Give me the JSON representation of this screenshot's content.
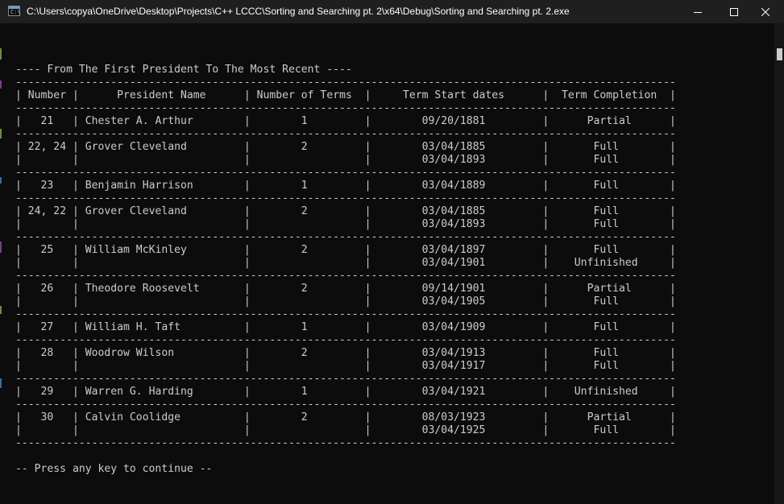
{
  "window": {
    "title": "C:\\Users\\copya\\OneDrive\\Desktop\\Projects\\C++ LCCC\\Sorting and Searching pt. 2\\x64\\Debug\\Sorting and Searching pt. 2.exe",
    "icon_label": "C:\\",
    "icons": {
      "app": "console-app-icon",
      "minimize": "minimize-icon",
      "maximize": "maximize-icon",
      "close": "close-icon"
    }
  },
  "console": {
    "heading": "---- From The First President To The Most Recent ----",
    "separator": "-----------------------------------------------------------------------------------------------------------",
    "columns": [
      "Number",
      "President Name",
      "Number of Terms",
      "Term Start dates",
      "Term Completion"
    ],
    "rows": [
      {
        "number": "21",
        "name": "Chester A. Arthur",
        "terms": "1",
        "starts": [
          "09/20/1881"
        ],
        "completion": [
          "Partial"
        ]
      },
      {
        "number": "22, 24",
        "name": "Grover Cleveland",
        "terms": "2",
        "starts": [
          "03/04/1885",
          "03/04/1893"
        ],
        "completion": [
          "Full",
          "Full"
        ]
      },
      {
        "number": "23",
        "name": "Benjamin Harrison",
        "terms": "1",
        "starts": [
          "03/04/1889"
        ],
        "completion": [
          "Full"
        ]
      },
      {
        "number": "24, 22",
        "name": "Grover Cleveland",
        "terms": "2",
        "starts": [
          "03/04/1885",
          "03/04/1893"
        ],
        "completion": [
          "Full",
          "Full"
        ]
      },
      {
        "number": "25",
        "name": "William McKinley",
        "terms": "2",
        "starts": [
          "03/04/1897",
          "03/04/1901"
        ],
        "completion": [
          "Full",
          "Unfinished"
        ]
      },
      {
        "number": "26",
        "name": "Theodore Roosevelt",
        "terms": "2",
        "starts": [
          "09/14/1901",
          "03/04/1905"
        ],
        "completion": [
          "Partial",
          "Full"
        ]
      },
      {
        "number": "27",
        "name": "William H. Taft",
        "terms": "1",
        "starts": [
          "03/04/1909"
        ],
        "completion": [
          "Full"
        ]
      },
      {
        "number": "28",
        "name": "Woodrow Wilson",
        "terms": "2",
        "starts": [
          "03/04/1913",
          "03/04/1917"
        ],
        "completion": [
          "Full",
          "Full"
        ]
      },
      {
        "number": "29",
        "name": "Warren G. Harding",
        "terms": "1",
        "starts": [
          "03/04/1921"
        ],
        "completion": [
          "Unfinished"
        ]
      },
      {
        "number": "30",
        "name": "Calvin Coolidge",
        "terms": "2",
        "starts": [
          "08/03/1923",
          "03/04/1925"
        ],
        "completion": [
          "Partial",
          "Full"
        ]
      }
    ],
    "prompt": "-- Press any key to continue --"
  },
  "colors": {
    "titlebar": "#1f1f1f",
    "console_bg": "#0c0c0c",
    "console_text": "#cccccc",
    "scrollbar_thumb": "#cdcdcd"
  }
}
